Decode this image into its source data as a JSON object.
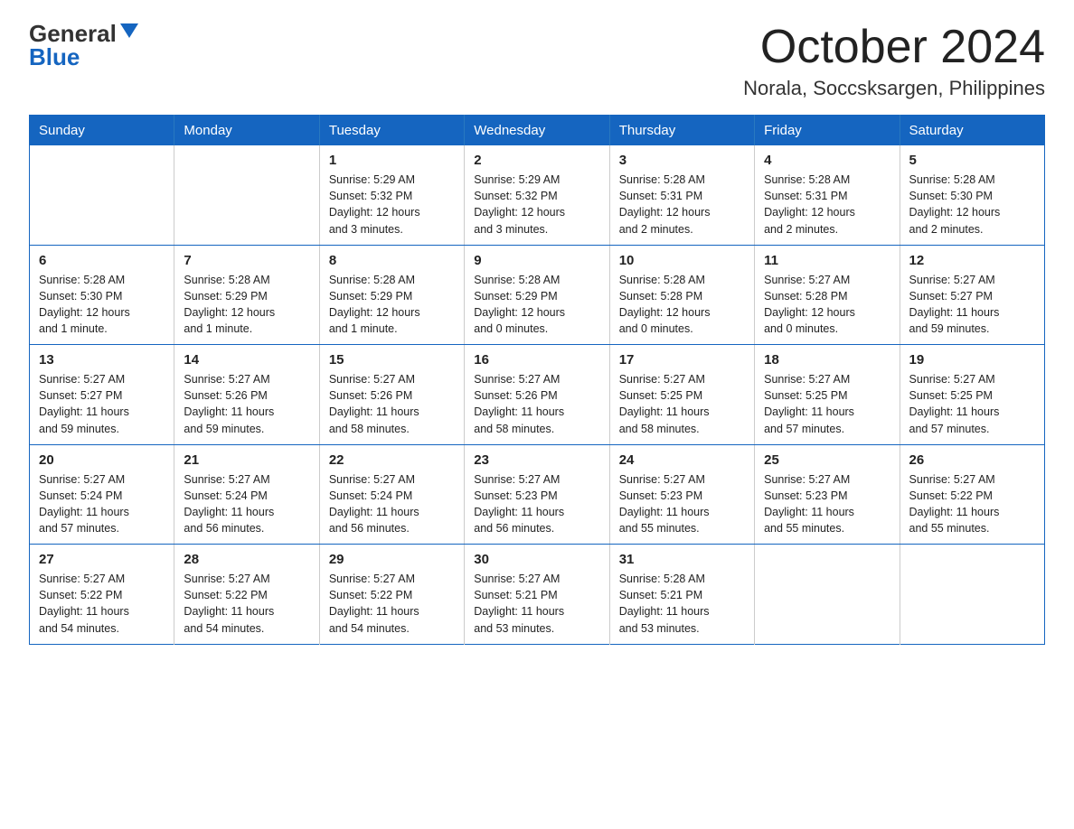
{
  "logo": {
    "general": "General",
    "blue": "Blue"
  },
  "title": {
    "month": "October 2024",
    "location": "Norala, Soccsksargen, Philippines"
  },
  "weekdays": [
    "Sunday",
    "Monday",
    "Tuesday",
    "Wednesday",
    "Thursday",
    "Friday",
    "Saturday"
  ],
  "weeks": [
    [
      {
        "day": "",
        "info": ""
      },
      {
        "day": "",
        "info": ""
      },
      {
        "day": "1",
        "info": "Sunrise: 5:29 AM\nSunset: 5:32 PM\nDaylight: 12 hours\nand 3 minutes."
      },
      {
        "day": "2",
        "info": "Sunrise: 5:29 AM\nSunset: 5:32 PM\nDaylight: 12 hours\nand 3 minutes."
      },
      {
        "day": "3",
        "info": "Sunrise: 5:28 AM\nSunset: 5:31 PM\nDaylight: 12 hours\nand 2 minutes."
      },
      {
        "day": "4",
        "info": "Sunrise: 5:28 AM\nSunset: 5:31 PM\nDaylight: 12 hours\nand 2 minutes."
      },
      {
        "day": "5",
        "info": "Sunrise: 5:28 AM\nSunset: 5:30 PM\nDaylight: 12 hours\nand 2 minutes."
      }
    ],
    [
      {
        "day": "6",
        "info": "Sunrise: 5:28 AM\nSunset: 5:30 PM\nDaylight: 12 hours\nand 1 minute."
      },
      {
        "day": "7",
        "info": "Sunrise: 5:28 AM\nSunset: 5:29 PM\nDaylight: 12 hours\nand 1 minute."
      },
      {
        "day": "8",
        "info": "Sunrise: 5:28 AM\nSunset: 5:29 PM\nDaylight: 12 hours\nand 1 minute."
      },
      {
        "day": "9",
        "info": "Sunrise: 5:28 AM\nSunset: 5:29 PM\nDaylight: 12 hours\nand 0 minutes."
      },
      {
        "day": "10",
        "info": "Sunrise: 5:28 AM\nSunset: 5:28 PM\nDaylight: 12 hours\nand 0 minutes."
      },
      {
        "day": "11",
        "info": "Sunrise: 5:27 AM\nSunset: 5:28 PM\nDaylight: 12 hours\nand 0 minutes."
      },
      {
        "day": "12",
        "info": "Sunrise: 5:27 AM\nSunset: 5:27 PM\nDaylight: 11 hours\nand 59 minutes."
      }
    ],
    [
      {
        "day": "13",
        "info": "Sunrise: 5:27 AM\nSunset: 5:27 PM\nDaylight: 11 hours\nand 59 minutes."
      },
      {
        "day": "14",
        "info": "Sunrise: 5:27 AM\nSunset: 5:26 PM\nDaylight: 11 hours\nand 59 minutes."
      },
      {
        "day": "15",
        "info": "Sunrise: 5:27 AM\nSunset: 5:26 PM\nDaylight: 11 hours\nand 58 minutes."
      },
      {
        "day": "16",
        "info": "Sunrise: 5:27 AM\nSunset: 5:26 PM\nDaylight: 11 hours\nand 58 minutes."
      },
      {
        "day": "17",
        "info": "Sunrise: 5:27 AM\nSunset: 5:25 PM\nDaylight: 11 hours\nand 58 minutes."
      },
      {
        "day": "18",
        "info": "Sunrise: 5:27 AM\nSunset: 5:25 PM\nDaylight: 11 hours\nand 57 minutes."
      },
      {
        "day": "19",
        "info": "Sunrise: 5:27 AM\nSunset: 5:25 PM\nDaylight: 11 hours\nand 57 minutes."
      }
    ],
    [
      {
        "day": "20",
        "info": "Sunrise: 5:27 AM\nSunset: 5:24 PM\nDaylight: 11 hours\nand 57 minutes."
      },
      {
        "day": "21",
        "info": "Sunrise: 5:27 AM\nSunset: 5:24 PM\nDaylight: 11 hours\nand 56 minutes."
      },
      {
        "day": "22",
        "info": "Sunrise: 5:27 AM\nSunset: 5:24 PM\nDaylight: 11 hours\nand 56 minutes."
      },
      {
        "day": "23",
        "info": "Sunrise: 5:27 AM\nSunset: 5:23 PM\nDaylight: 11 hours\nand 56 minutes."
      },
      {
        "day": "24",
        "info": "Sunrise: 5:27 AM\nSunset: 5:23 PM\nDaylight: 11 hours\nand 55 minutes."
      },
      {
        "day": "25",
        "info": "Sunrise: 5:27 AM\nSunset: 5:23 PM\nDaylight: 11 hours\nand 55 minutes."
      },
      {
        "day": "26",
        "info": "Sunrise: 5:27 AM\nSunset: 5:22 PM\nDaylight: 11 hours\nand 55 minutes."
      }
    ],
    [
      {
        "day": "27",
        "info": "Sunrise: 5:27 AM\nSunset: 5:22 PM\nDaylight: 11 hours\nand 54 minutes."
      },
      {
        "day": "28",
        "info": "Sunrise: 5:27 AM\nSunset: 5:22 PM\nDaylight: 11 hours\nand 54 minutes."
      },
      {
        "day": "29",
        "info": "Sunrise: 5:27 AM\nSunset: 5:22 PM\nDaylight: 11 hours\nand 54 minutes."
      },
      {
        "day": "30",
        "info": "Sunrise: 5:27 AM\nSunset: 5:21 PM\nDaylight: 11 hours\nand 53 minutes."
      },
      {
        "day": "31",
        "info": "Sunrise: 5:28 AM\nSunset: 5:21 PM\nDaylight: 11 hours\nand 53 minutes."
      },
      {
        "day": "",
        "info": ""
      },
      {
        "day": "",
        "info": ""
      }
    ]
  ]
}
